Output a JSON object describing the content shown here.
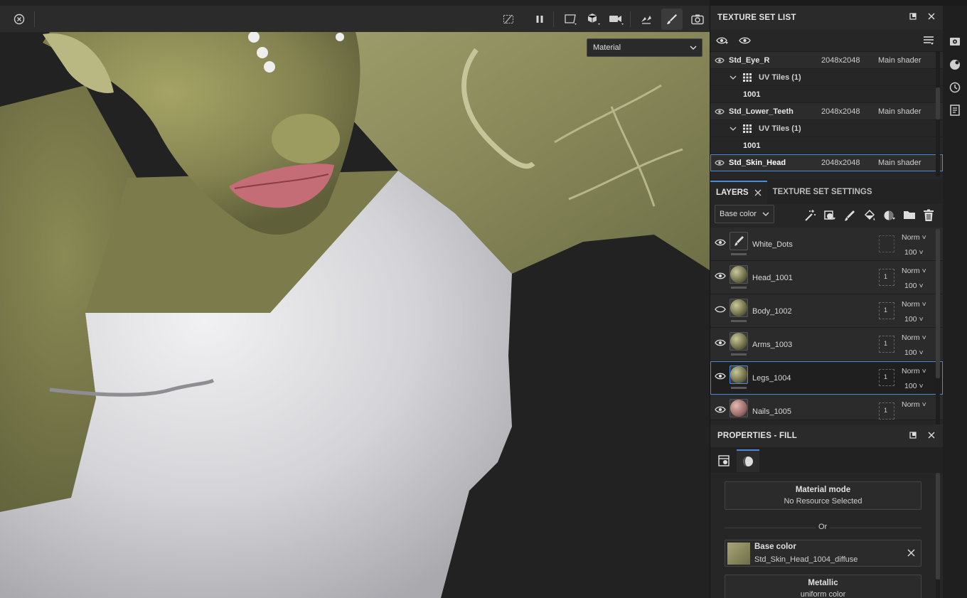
{
  "viewport": {
    "material_dropdown": "Material"
  },
  "texture_set_list": {
    "title": "TEXTURE SET LIST",
    "rows": [
      {
        "name": "Std_Eye_R",
        "resolution": "2048x2048",
        "shader": "Main shader"
      },
      {
        "uv_label": "UV Tiles (1)"
      },
      {
        "tile": "1001"
      },
      {
        "name": "Std_Lower_Teeth",
        "resolution": "2048x2048",
        "shader": "Main shader"
      },
      {
        "uv_label": "UV Tiles (1)"
      },
      {
        "tile": "1001"
      },
      {
        "name": "Std_Skin_Head",
        "resolution": "2048x2048",
        "shader": "Main shader"
      }
    ]
  },
  "layers": {
    "tab_layers": "LAYERS",
    "tab_settings": "TEXTURE SET SETTINGS",
    "channel": "Base color",
    "items": [
      {
        "name": "White_Dots",
        "blend": "Norm",
        "opacity": "100",
        "mask": ""
      },
      {
        "name": "Head_1001",
        "blend": "Norm",
        "opacity": "100",
        "mask": "1"
      },
      {
        "name": "Body_1002",
        "blend": "Norm",
        "opacity": "100",
        "mask": "1"
      },
      {
        "name": "Arms_1003",
        "blend": "Norm",
        "opacity": "100",
        "mask": "1"
      },
      {
        "name": "Legs_1004",
        "blend": "Norm",
        "opacity": "100",
        "mask": "1"
      },
      {
        "name": "Nails_1005",
        "blend": "Norm",
        "opacity": "",
        "mask": "1"
      }
    ]
  },
  "properties": {
    "title": "PROPERTIES - FILL",
    "material_mode_title": "Material mode",
    "material_mode_value": "No Resource Selected",
    "or_label": "Or",
    "base_color_title": "Base color",
    "base_color_value": "Std_Skin_Head_1004_diffuse",
    "metallic_title": "Metallic",
    "metallic_value": "uniform color"
  },
  "colors": {
    "accent": "#4a8ad8",
    "skin": "#8b8a52",
    "shirt": "#d9d9dc"
  }
}
